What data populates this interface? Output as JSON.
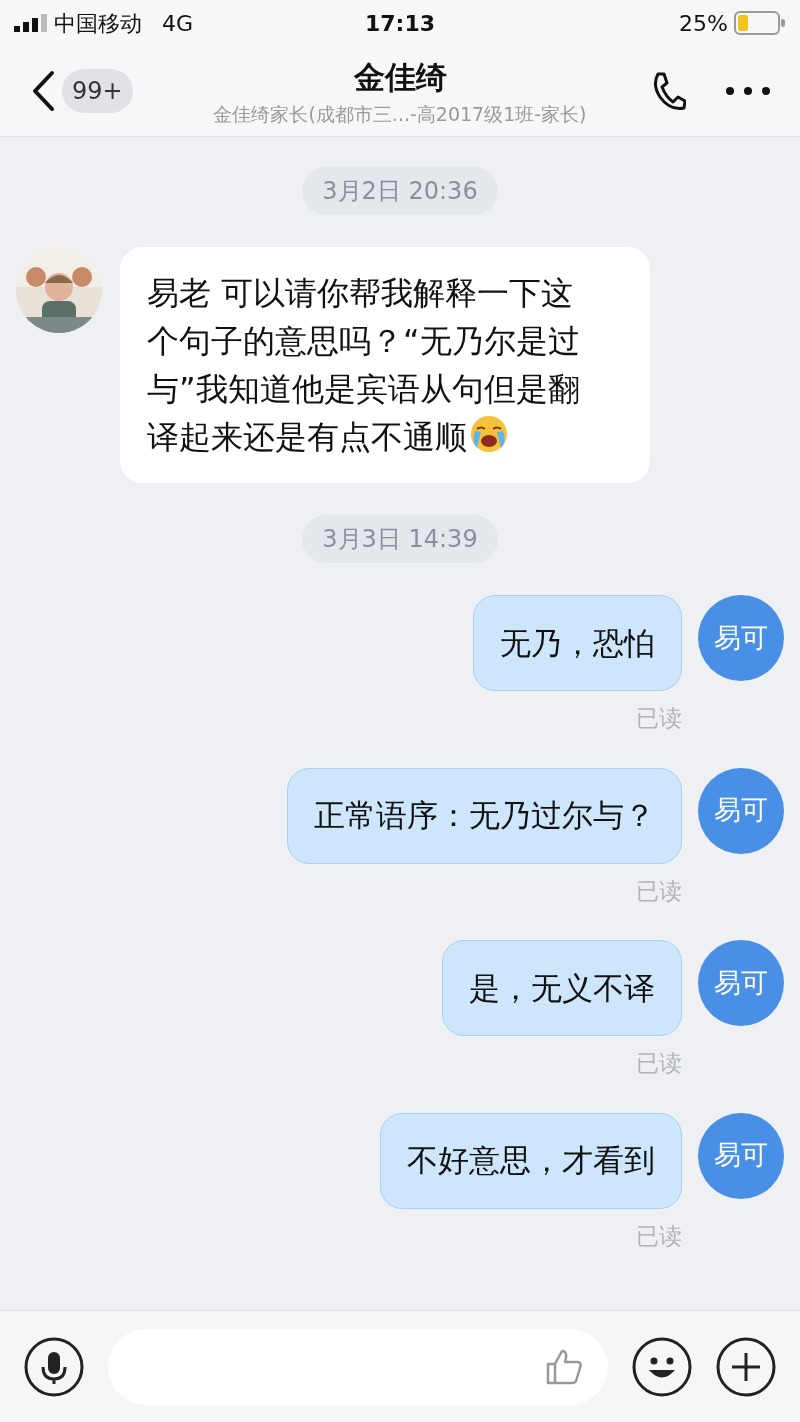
{
  "status_bar": {
    "carrier": "中国移动",
    "network": "4G",
    "time": "17:13",
    "battery": "25%"
  },
  "header": {
    "back_badge": "99+",
    "title": "金佳绮",
    "subtitle": "金佳绮家长(成都市三...-高2017级1班-家长)"
  },
  "messages": [
    {
      "kind": "time",
      "text": "3月2日 20:36"
    },
    {
      "kind": "incoming",
      "text": "易老 可以请你帮我解释一下这个句子的意思吗？“无乃尔是过与”我知道他是宾语从句但是翻译起来还是有点不通顺",
      "emoji": true
    },
    {
      "kind": "time",
      "text": "3月3日 14:39"
    },
    {
      "kind": "outgoing",
      "avatar": "易可",
      "text": "无乃，恐怕",
      "receipt": "已读"
    },
    {
      "kind": "outgoing",
      "avatar": "易可",
      "text": "正常语序：无乃过尔与？",
      "receipt": "已读"
    },
    {
      "kind": "outgoing",
      "avatar": "易可",
      "text": "是，无义不译",
      "receipt": "已读"
    },
    {
      "kind": "outgoing",
      "avatar": "易可",
      "text": "不好意思，才看到",
      "receipt": "已读"
    }
  ]
}
